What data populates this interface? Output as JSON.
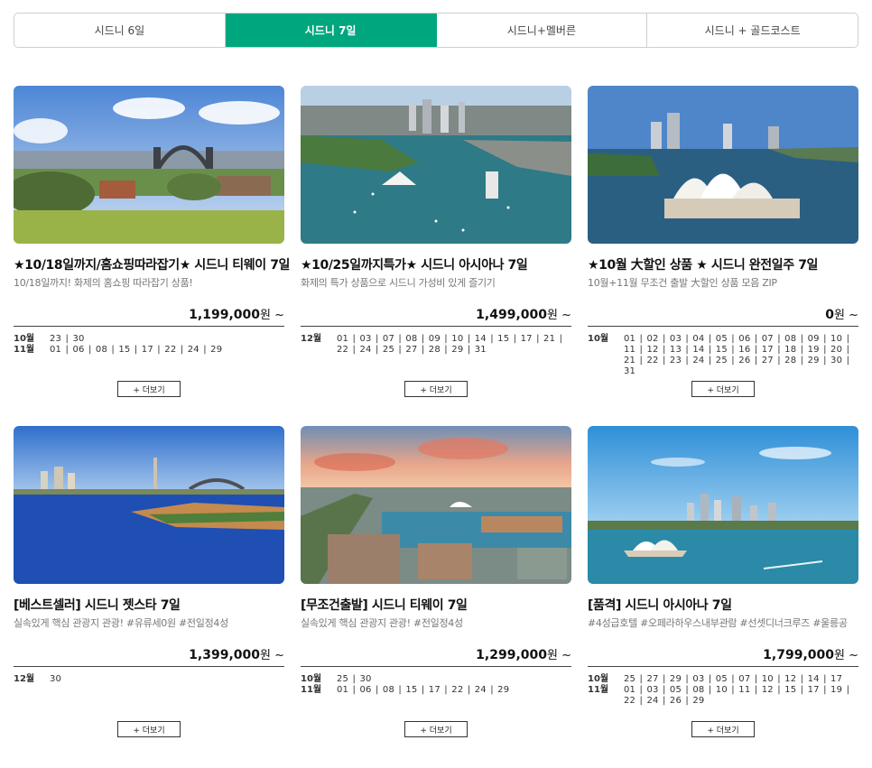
{
  "tabs": [
    {
      "label": "시드니 6일",
      "active": false
    },
    {
      "label": "시드니 7일",
      "active": true
    },
    {
      "label": "시드니+멜버른",
      "active": false
    },
    {
      "label": "시드니 + 골드코스트",
      "active": false
    }
  ],
  "accent_color": "#00a77e",
  "more_label": "+ 더보기",
  "products": [
    {
      "title": "★10/18일까지/홈쇼핑따라잡기★ 시드니 티웨이 7일",
      "subtitle": "10/18일까지! 화제의 홈쇼핑 따라잡기 상품!",
      "price": "1,199,000",
      "currency": "원 ~",
      "departures": [
        {
          "month": "10월",
          "days": "23 | 30"
        },
        {
          "month": "11월",
          "days": "01 | 06 | 08 | 15 | 17 | 22 | 24 | 29"
        }
      ]
    },
    {
      "title": "★10/25일까지특가★ 시드니 아시아나 7일",
      "subtitle": "화제의 특가 상품으로 시드니 가성비 있게 즐기기",
      "price": "1,499,000",
      "currency": "원 ~",
      "departures": [
        {
          "month": "12월",
          "days": "01 | 03 | 07 | 08 | 09 | 10 | 14 | 15 | 17 | 21 | 22 | 24 | 25 | 27 | 28 | 29 | 31"
        }
      ]
    },
    {
      "title": "★10월 大할인 상품 ★ 시드니 완전일주 7일",
      "subtitle": "10월+11월 무조건 출발 大할인 상품 모음 ZIP",
      "price": "0",
      "currency": "원 ~",
      "departures": [
        {
          "month": "10월",
          "days": "01 | 02 | 03 | 04 | 05 | 06 | 07 | 08 | 09 | 10 | 11 | 12 | 13 | 14 | 15 | 16 | 17 | 18 | 19 | 20 | 21 | 22 | 23 | 24 | 25 | 26 | 27 | 28 | 29 | 30 | 31"
        }
      ]
    },
    {
      "title": "[베스트셀러] 시드니 젯스타 7일",
      "subtitle": "실속있게 핵심 관광지 관광! #유류세0원 #전일정4성",
      "price": "1,399,000",
      "currency": "원 ~",
      "departures": [
        {
          "month": "12월",
          "days": "30"
        }
      ]
    },
    {
      "title": "[무조건출발] 시드니 티웨이 7일",
      "subtitle": "실속있게 핵심 관광지 관광! #전일정4성",
      "price": "1,299,000",
      "currency": "원 ~",
      "departures": [
        {
          "month": "10월",
          "days": "25 | 30"
        },
        {
          "month": "11월",
          "days": "01 | 06 | 08 | 15 | 17 | 22 | 24 | 29"
        }
      ]
    },
    {
      "title": "[품격] 시드니 아시아나 7일",
      "subtitle": "#4성급호텔 #오페라하우스내부관람 #선셋디너크루즈 #울릉공",
      "price": "1,799,000",
      "currency": "원 ~",
      "departures": [
        {
          "month": "10월",
          "days": "25 | 27 | 29 | 03 | 05 | 07 | 10 | 12 | 14 | 17"
        },
        {
          "month": "11월",
          "days": "01 | 03 | 05 | 08 | 10 | 11 | 12 | 15 | 17 | 19 | 22 | 24 | 26 | 29"
        }
      ]
    }
  ]
}
